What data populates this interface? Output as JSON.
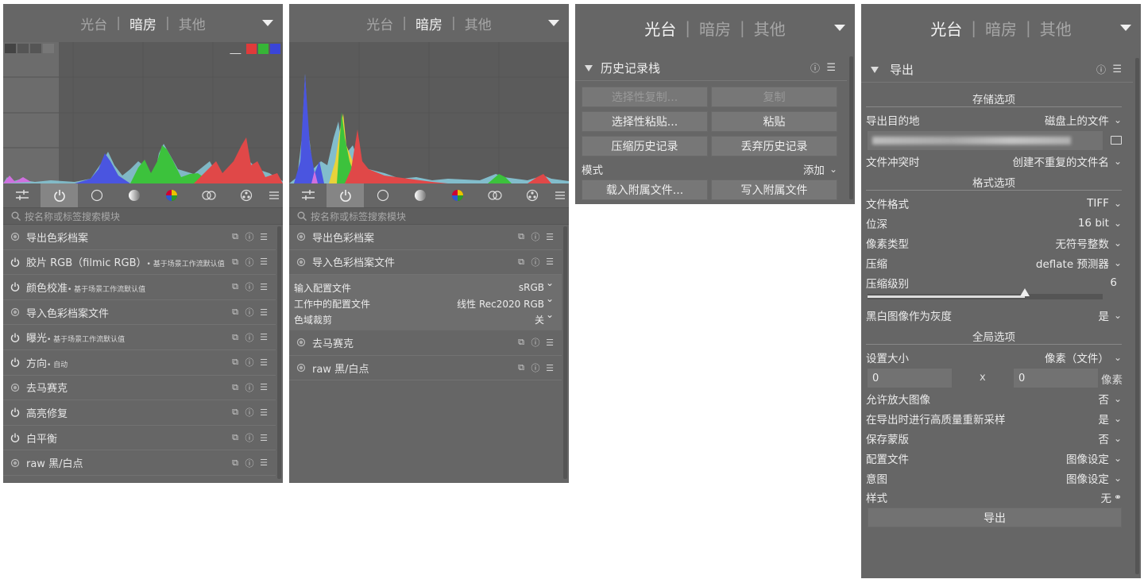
{
  "header": {
    "tabs": [
      "光台",
      "暗房",
      "其他"
    ],
    "sep": "|"
  },
  "panel1": {
    "search_placeholder": "按名称或标签搜索模块",
    "histogram_colors": [
      "#e03a3a",
      "#36b536",
      "#3a45d8"
    ],
    "modules": [
      {
        "name": "导出色彩档案",
        "note": "",
        "power": false
      },
      {
        "name": "胶片 RGB（filmic RGB）",
        "note": "• 基于场景工作流默认值",
        "power": true
      },
      {
        "name": "颜色校准",
        "note": "• 基于场景工作流默认值",
        "power": true
      },
      {
        "name": "导入色彩档案文件",
        "note": "",
        "power": false
      },
      {
        "name": "曝光",
        "note": "• 基于场景工作流默认值",
        "power": true
      },
      {
        "name": "方向",
        "note": "• 自动",
        "power": true
      },
      {
        "name": "去马赛克",
        "note": "",
        "power": false
      },
      {
        "name": "高亮修复",
        "note": "",
        "power": true
      },
      {
        "name": "白平衡",
        "note": "",
        "power": true
      },
      {
        "name": "raw 黑/白点",
        "note": "",
        "power": false
      }
    ]
  },
  "panel2": {
    "search_placeholder": "按名称或标签搜索模块",
    "modules_top": [
      {
        "name": "导出色彩档案"
      },
      {
        "name": "导入色彩档案文件"
      }
    ],
    "expanded": [
      {
        "label": "输入配置文件",
        "value": "sRGB"
      },
      {
        "label": "工作中的配置文件",
        "value": "线性 Rec2020 RGB"
      },
      {
        "label": "色域裁剪",
        "value": "关"
      }
    ],
    "modules_bottom": [
      {
        "name": "去马赛克"
      },
      {
        "name": "raw 黑/白点"
      }
    ]
  },
  "panel3": {
    "title": "历史记录栈",
    "buttons": [
      [
        "选择性复制...",
        "复制"
      ],
      [
        "选择性粘贴...",
        "粘贴"
      ],
      [
        "压缩历史记录",
        "丢弃历史记录"
      ]
    ],
    "mode_label": "模式",
    "mode_value": "添加",
    "buttons2": [
      "载入附属文件...",
      "写入附属文件"
    ]
  },
  "panel4": {
    "title": "导出",
    "storage_header": "存储选项",
    "dest_label": "导出目的地",
    "dest_value": "磁盘上的文件",
    "conflict_label": "文件冲突时",
    "conflict_value": "创建不重复的文件名",
    "format_header": "格式选项",
    "format_rows": [
      {
        "label": "文件格式",
        "value": "TIFF"
      },
      {
        "label": "位深",
        "value": "16 bit"
      },
      {
        "label": "像素类型",
        "value": "无符号整数"
      },
      {
        "label": "压缩",
        "value": "deflate 预测器"
      }
    ],
    "comp_level_label": "压缩级别",
    "comp_level_value": "6",
    "comp_level_fraction": 0.67,
    "bw_label": "黑白图像作为灰度",
    "bw_value": "是",
    "global_header": "全局选项",
    "size_label": "设置大小",
    "size_value": "像素（文件）",
    "width_value": "0",
    "times": "x",
    "height_value": "0",
    "px_unit": "像素",
    "global_rows": [
      {
        "label": "允许放大图像",
        "value": "否"
      },
      {
        "label": "在导出时进行高质量重新采样",
        "value": "是"
      },
      {
        "label": "保存蒙版",
        "value": "否"
      },
      {
        "label": "配置文件",
        "value": "图像设定"
      },
      {
        "label": "意图",
        "value": "图像设定"
      }
    ],
    "style_label": "样式",
    "style_value": "无",
    "export_button": "导出"
  }
}
